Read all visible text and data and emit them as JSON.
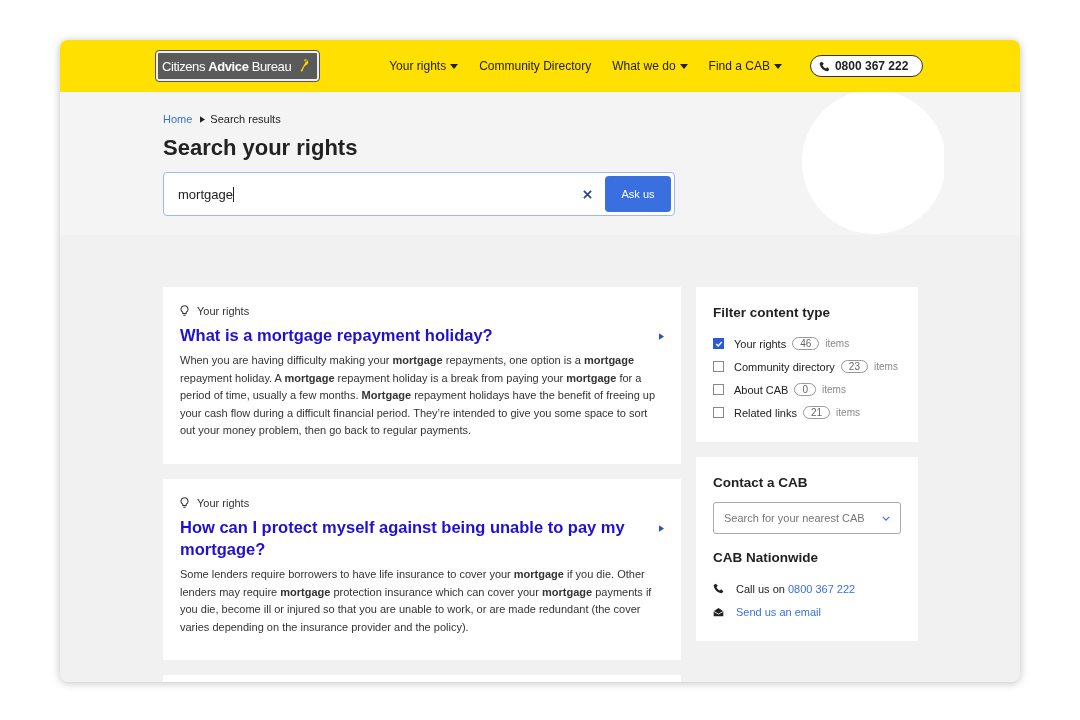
{
  "header": {
    "logo": "Citizens **Advice** Bureau",
    "nav": [
      {
        "label": "Your rights",
        "dropdown": true
      },
      {
        "label": "Community Directory",
        "dropdown": false
      },
      {
        "label": "What we do",
        "dropdown": true
      },
      {
        "label": "Find a CAB",
        "dropdown": true
      }
    ],
    "phone": "0800 367 222"
  },
  "breadcrumb": [
    {
      "label": "Home",
      "link": true
    },
    {
      "label": "Search results",
      "link": false
    }
  ],
  "heading": "Search your rights",
  "search": {
    "value": "mortgage",
    "button": "Ask us"
  },
  "results": [
    {
      "category": "Your rights",
      "title": "What is a mortgage repayment holiday?",
      "body": "When you are having difficulty making your **mortgage** repayments, one option is a **mortgage** repayment holiday. A **mortgage** repayment holiday is a break from paying your **mortgage** for a period of time, usually a few months. **Mortgage** repayment holidays have the benefit of freeing up your cash flow during a difficult financial period. They’re intended to give you some space to sort out your money problem, then go back to regular payments."
    },
    {
      "category": "Your rights",
      "title": "How can I protect myself against being unable to pay my mortgage?",
      "body": "Some lenders require borrowers to have life insurance to cover your **mortgage** if you die. Other lenders may require **mortgage** protection insurance which can cover your **mortgage** payments if you die, become ill or injured so that you are unable to work, or are made redundant (the cover varies depending on the insurance provider and the policy)."
    }
  ],
  "filter": {
    "title": "Filter content type",
    "items": [
      {
        "label": "Your rights",
        "count": "46",
        "unit": "items",
        "checked": true
      },
      {
        "label": "Community directory",
        "count": "23",
        "unit": "items",
        "checked": false
      },
      {
        "label": "About CAB",
        "count": "0",
        "unit": "items",
        "checked": false
      },
      {
        "label": "Related links",
        "count": "21",
        "unit": "items",
        "checked": false
      }
    ]
  },
  "contact": {
    "title": "Contact a CAB",
    "select_placeholder": "Search for your nearest CAB",
    "nationwide_title": "CAB Nationwide",
    "lines": [
      {
        "kind": "phone",
        "text": "Call us on",
        "link": "0800 367 222"
      },
      {
        "kind": "email",
        "link": "Send us an email"
      }
    ]
  }
}
